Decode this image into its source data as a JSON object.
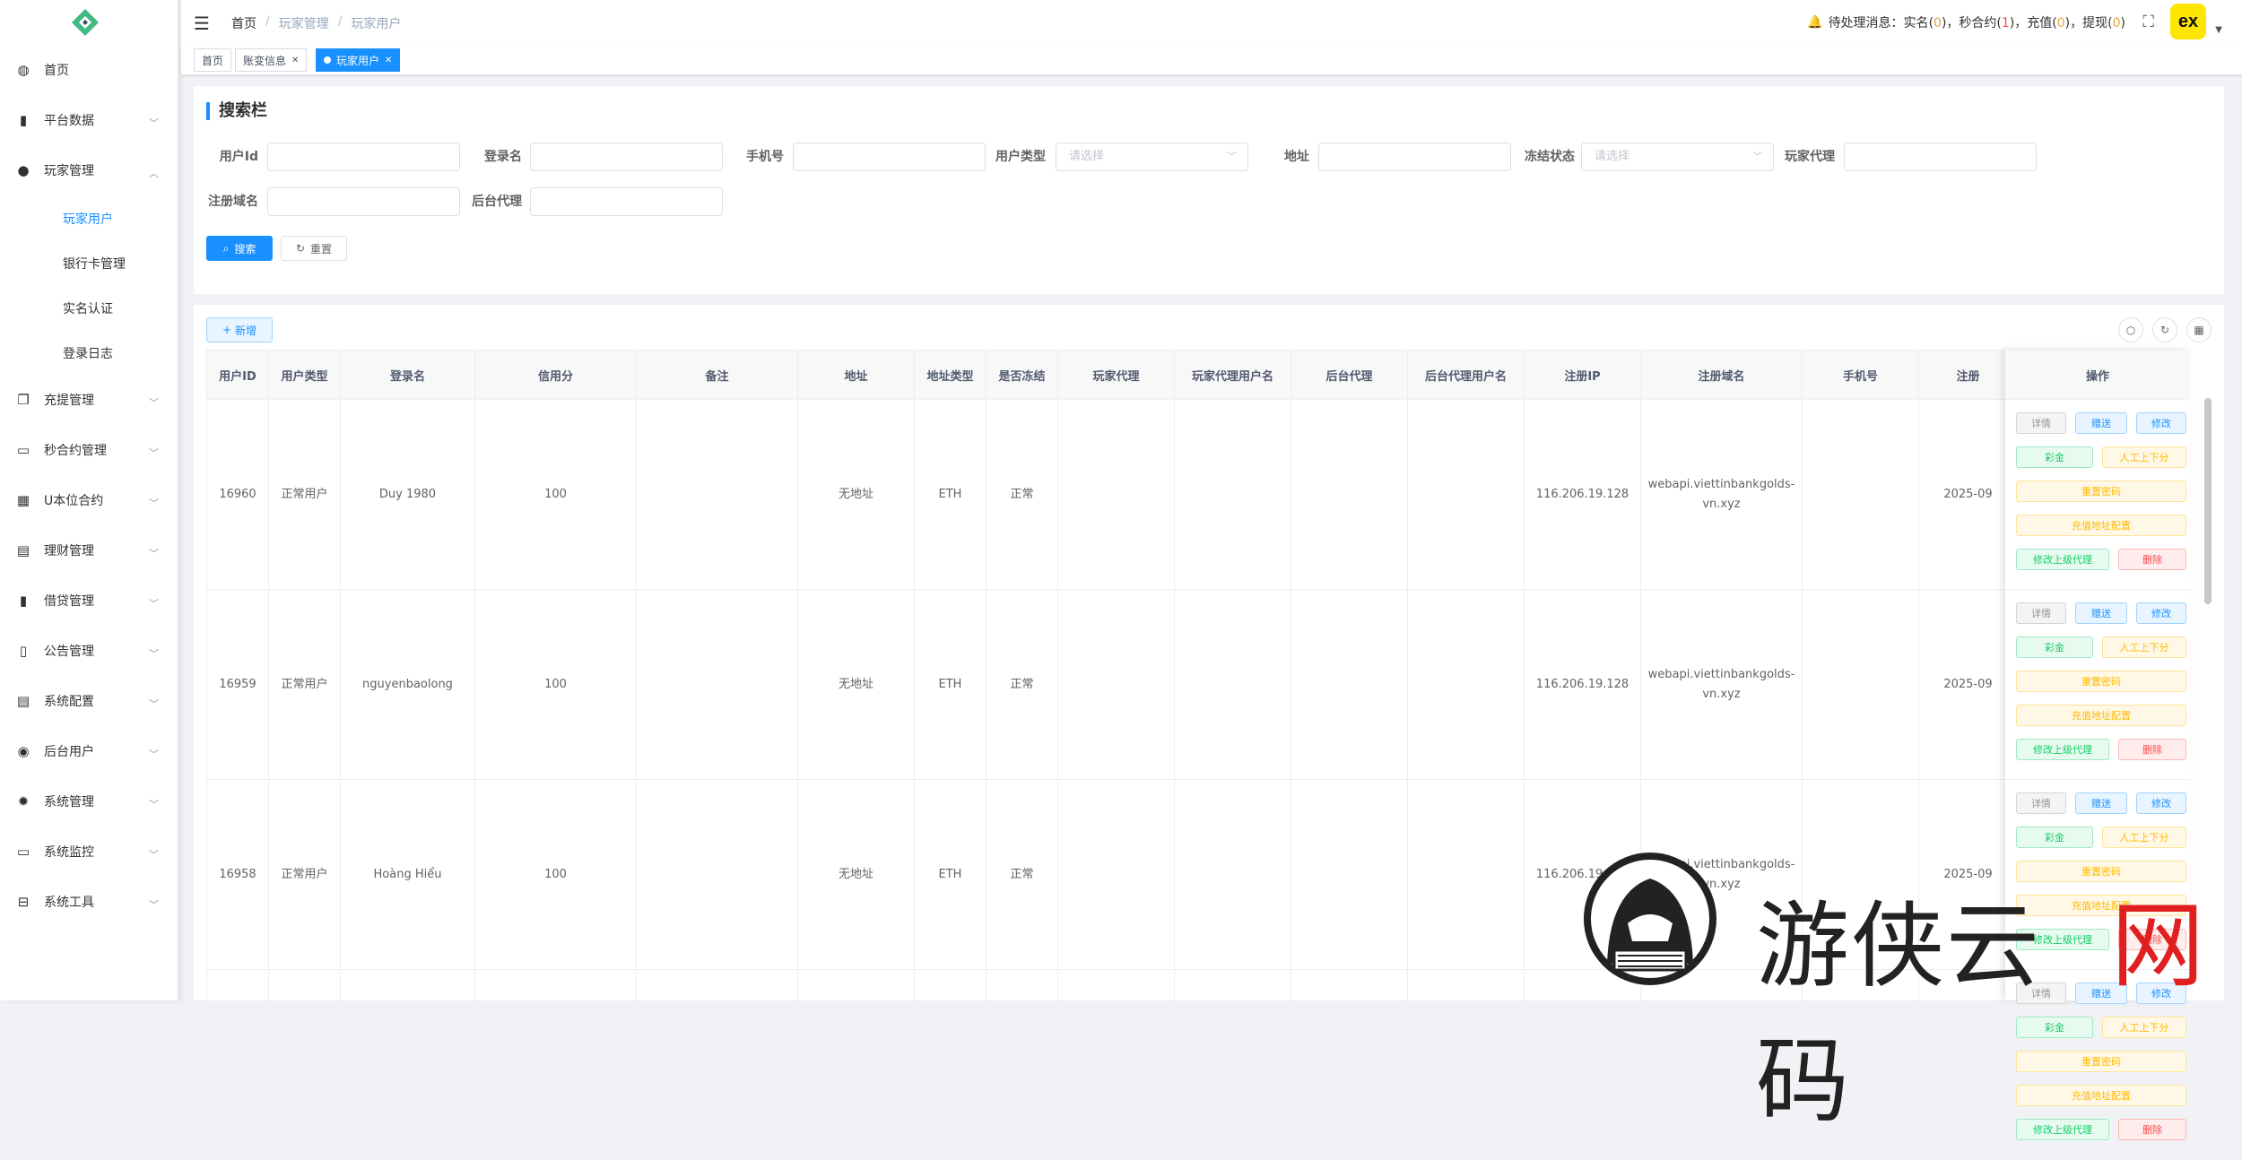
{
  "colors": {
    "accent": "#1890ff",
    "success": "#13ce66",
    "warning": "#ffba00",
    "danger": "#ff4949",
    "info": "#909399",
    "avatar_bg": "#ffe600"
  },
  "sidebar": {
    "logo_icon": "logo-diamond-icon",
    "items": [
      {
        "label": "首页",
        "icon": "dashboard-icon",
        "expandable": false
      },
      {
        "label": "平台数据",
        "icon": "book-icon",
        "expandable": true
      },
      {
        "label": "玩家管理",
        "icon": "user-icon",
        "expandable": true,
        "expanded": true
      },
      {
        "label": "充提管理",
        "icon": "copy-icon",
        "expandable": true
      },
      {
        "label": "秒合约管理",
        "icon": "monitor-icon",
        "expandable": true
      },
      {
        "label": "U本位合约",
        "icon": "grid-icon",
        "expandable": true
      },
      {
        "label": "理财管理",
        "icon": "document-icon",
        "expandable": true
      },
      {
        "label": "借贷管理",
        "icon": "book-icon",
        "expandable": true
      },
      {
        "label": "公告管理",
        "icon": "open-book-icon",
        "expandable": true
      },
      {
        "label": "系统配置",
        "icon": "doc-list-icon",
        "expandable": true
      },
      {
        "label": "后台用户",
        "icon": "users-icon",
        "expandable": true
      },
      {
        "label": "系统管理",
        "icon": "gear-icon",
        "expandable": true
      },
      {
        "label": "系统监控",
        "icon": "monitor-icon",
        "expandable": true
      },
      {
        "label": "系统工具",
        "icon": "tool-icon",
        "expandable": true
      }
    ],
    "sub_items": [
      {
        "label": "玩家用户",
        "active": true
      },
      {
        "label": "银行卡管理",
        "active": false
      },
      {
        "label": "实名认证",
        "active": false
      },
      {
        "label": "登录日志",
        "active": false
      }
    ]
  },
  "header": {
    "breadcrumb": [
      "首页",
      "玩家管理",
      "玩家用户"
    ],
    "notice": {
      "prefix": "待处理消息：",
      "realname_label": "实名",
      "realname_count": "0",
      "seconds_label": "秒合约",
      "seconds_count": "1",
      "recharge_label": "充值",
      "recharge_count": "0",
      "withdraw_label": "提现",
      "withdraw_count": "0"
    },
    "avatar_text": "ex"
  },
  "tags": [
    {
      "label": "首页",
      "active": false,
      "closable": false
    },
    {
      "label": "账变信息",
      "active": false,
      "closable": true
    },
    {
      "label": "玩家用户",
      "active": true,
      "closable": true
    }
  ],
  "search": {
    "title": "搜索栏",
    "fields": [
      {
        "label": "用户Id",
        "type": "input",
        "value": "",
        "placeholder": ""
      },
      {
        "label": "登录名",
        "type": "input",
        "value": "",
        "placeholder": ""
      },
      {
        "label": "手机号",
        "type": "input",
        "value": "",
        "placeholder": ""
      },
      {
        "label": "用户类型",
        "type": "select",
        "value": "",
        "placeholder": "请选择"
      },
      {
        "label": "地址",
        "type": "input",
        "value": "",
        "placeholder": ""
      },
      {
        "label": "冻结状态",
        "type": "select",
        "value": "",
        "placeholder": "请选择"
      },
      {
        "label": "玩家代理",
        "type": "input",
        "value": "",
        "placeholder": ""
      },
      {
        "label": "注册域名",
        "type": "input",
        "value": "",
        "placeholder": ""
      },
      {
        "label": "后台代理",
        "type": "input",
        "value": "",
        "placeholder": ""
      }
    ],
    "search_label": "搜索",
    "reset_label": "重置"
  },
  "toolbar": {
    "add_label": "新增"
  },
  "table": {
    "columns": [
      "用户ID",
      "用户类型",
      "登录名",
      "信用分",
      "备注",
      "地址",
      "地址类型",
      "是否冻结",
      "玩家代理",
      "玩家代理用户名",
      "后台代理",
      "后台代理用户名",
      "注册IP",
      "注册域名",
      "手机号",
      "注册"
    ],
    "operations_header": "操作",
    "rows": [
      {
        "cells": [
          "16960",
          "正常用户",
          "Duy 1980",
          "100",
          "",
          "无地址",
          "ETH",
          "正常",
          "",
          "",
          "",
          "",
          "116.206.19.128",
          "webapi.viettinbankgolds-vn.xyz",
          "",
          "2025-09"
        ]
      },
      {
        "cells": [
          "16959",
          "正常用户",
          "nguyenbaolong",
          "100",
          "",
          "无地址",
          "ETH",
          "正常",
          "",
          "",
          "",
          "",
          "116.206.19.128",
          "webapi.viettinbankgolds-vn.xyz",
          "",
          "2025-09"
        ]
      },
      {
        "cells": [
          "16958",
          "正常用户",
          "Hoàng Hiểu",
          "100",
          "",
          "无地址",
          "ETH",
          "正常",
          "",
          "",
          "",
          "",
          "116.206.19.128",
          "webapi.viettinbankgolds-vn.xyz",
          "",
          "2025-09"
        ]
      }
    ],
    "row_actions": {
      "detail": "详情",
      "bonus": "赠送",
      "edit": "修改",
      "caijin": "彩金",
      "manual": "人工上下分",
      "reset_pwd": "重置密码",
      "recharge_addr": "充值地址配置",
      "edit_agent": "修改上级代理",
      "delete": "删除"
    }
  },
  "watermark": {
    "text_dark": "游侠云码",
    "text_red": "网",
    "logo": "hacker-hood-icon"
  }
}
